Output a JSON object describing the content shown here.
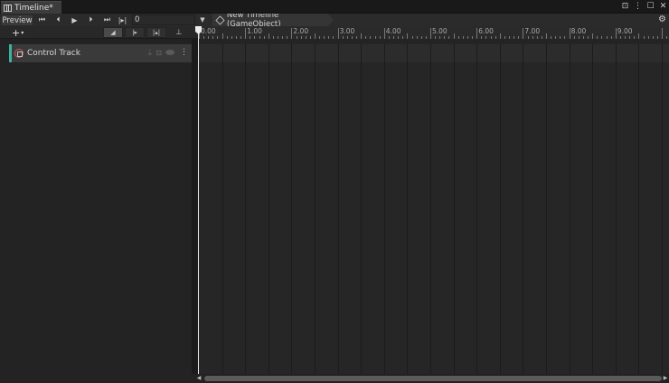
{
  "window": {
    "tab_title": "Timeline*",
    "lock_icon": "lock-icon",
    "menu_icon": "kebab-menu-icon",
    "maximize_icon": "maximize-icon",
    "close_icon": "close-icon"
  },
  "toolbar": {
    "preview_label": "Preview",
    "buttons": [
      {
        "name": "goto-start-button",
        "glyph": "⏮"
      },
      {
        "name": "previous-frame-button",
        "glyph": "⏴"
      },
      {
        "name": "play-button",
        "glyph": "▶"
      },
      {
        "name": "next-frame-button",
        "glyph": "⏵"
      },
      {
        "name": "goto-end-button",
        "glyph": "⏭"
      },
      {
        "name": "play-range-button",
        "glyph": "|▸|"
      }
    ],
    "frame_value": "0",
    "breadcrumb": "New Timeline (GameObject)"
  },
  "subtoolbar": {
    "add_label": "+",
    "add_dropdown": "▾"
  },
  "ruler": {
    "labels": [
      "0.00",
      "1.00",
      "2.00",
      "3.00",
      "4.00",
      "5.00",
      "6.00",
      "7.00",
      "8.00",
      "9.00"
    ]
  },
  "tracks": [
    {
      "name": "Control Track",
      "color": "#3fb0a0"
    }
  ],
  "colors": {
    "background": "#1e1e1e",
    "track_accent": "#3fb0a0",
    "playhead": "#e6e6e6"
  }
}
